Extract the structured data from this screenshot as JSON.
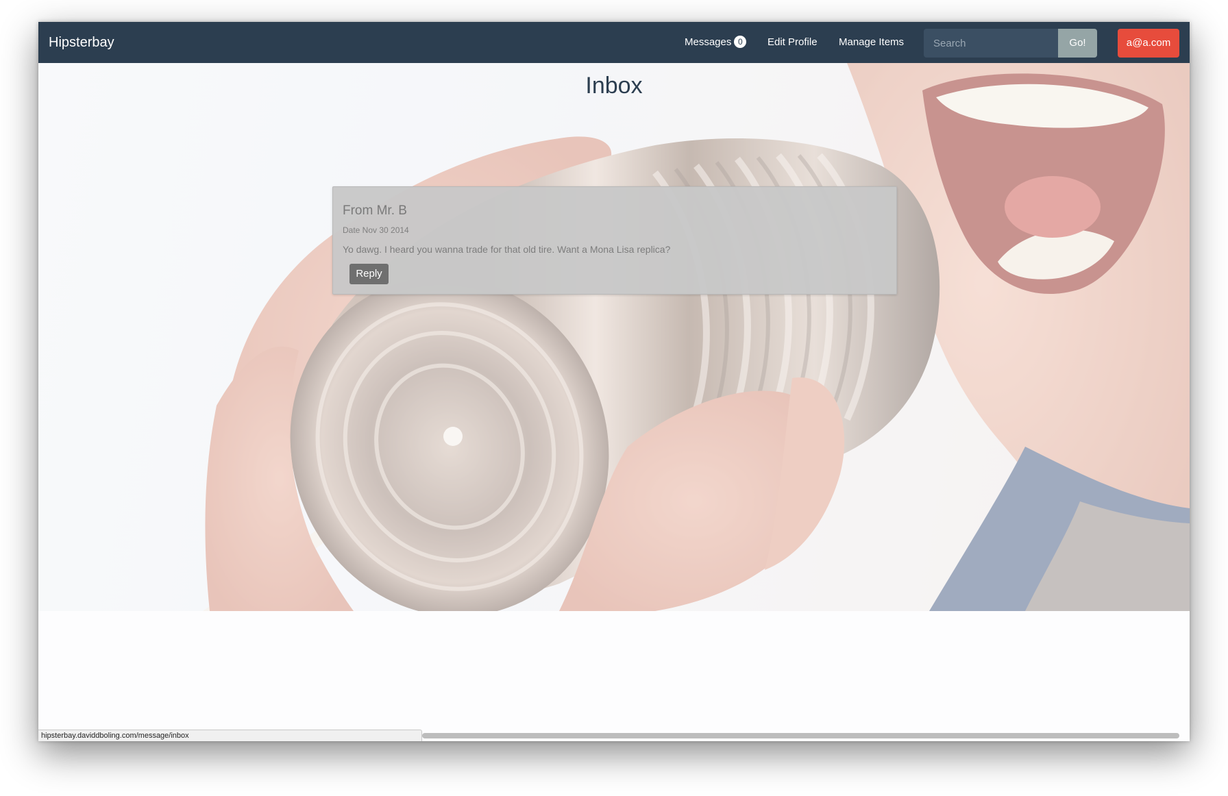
{
  "navbar": {
    "brand": "Hipsterbay",
    "messages_label": "Messages",
    "messages_count": "0",
    "edit_profile_label": "Edit Profile",
    "manage_items_label": "Manage Items",
    "search_placeholder": "Search",
    "go_label": "Go!",
    "user_label": "a@a.com"
  },
  "main": {
    "title": "Inbox",
    "messages": [
      {
        "from": "From Mr. B",
        "date": "Date Nov 30 2014",
        "body": "Yo dawg. I heard you wanna trade for that old tire. Want a Mona Lisa replica?",
        "reply_label": "Reply"
      }
    ]
  },
  "status_bar": {
    "url": "hipsterbay.daviddboling.com/message/inbox"
  },
  "colors": {
    "navbar": "#2c3e50",
    "go_button": "#95a5a6",
    "user_button": "#e74c3c",
    "reply_button": "#6f6f6f"
  }
}
